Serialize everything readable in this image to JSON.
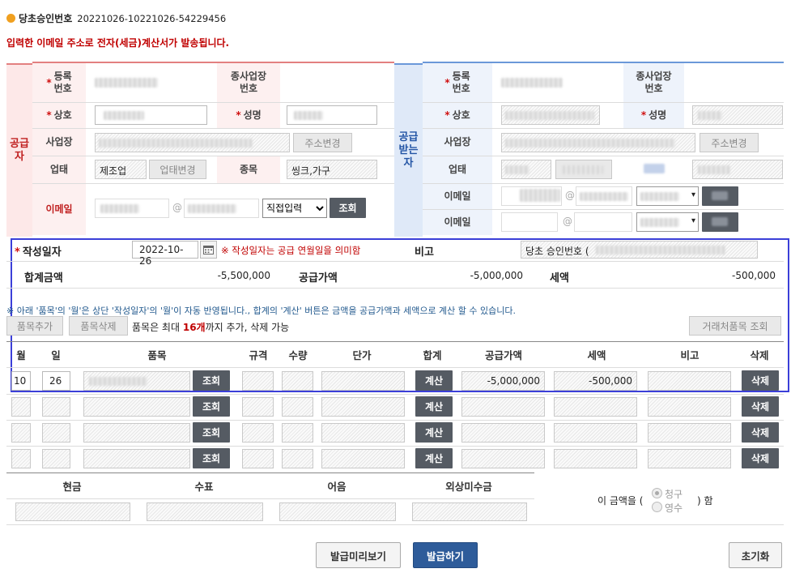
{
  "header": {
    "title": "당초승인번호",
    "approval_number": "20221026-10221026-54229456"
  },
  "notice": "입력한 이메일 주소로 전자(세금)계산서가 발송됩니다.",
  "supplier": {
    "side_label": "공급\n자",
    "reg_label": "등록\n번호",
    "sub_label": "종사업장\n번호",
    "name_label": "상호",
    "ceo_label": "성명",
    "address_label": "사업장",
    "address_btn": "주소변경",
    "biz_type_label": "업태",
    "biz_type_value": "제조업",
    "biz_type_btn": "업태변경",
    "item_label": "종목",
    "item_value": "씽크,가구",
    "email_label": "이메일",
    "email_at": "@",
    "email_domain_select": "직접입력",
    "lookup_btn": "조회"
  },
  "receiver": {
    "side_label": "공급\n받는\n자",
    "reg_label": "등록\n번호",
    "sub_label": "종사업장\n번호",
    "name_label": "상호",
    "ceo_label": "성명",
    "address_label": "사업장",
    "address_btn": "주소변경",
    "biz_type_label": "업태",
    "email_label1": "이메일",
    "email_label2": "이메일",
    "email_at": "@"
  },
  "summary": {
    "date_label": "작성일자",
    "date_value": "2022-10-26",
    "date_note": "※ 작성일자는 공급 연월일을 의미함",
    "remark_label": "비고",
    "remark_value": "당초 승인번호 (",
    "total_label": "합계금액",
    "total_value": "-5,500,000",
    "supply_label": "공급가액",
    "supply_value": "-5,000,000",
    "tax_label": "세액",
    "tax_value": "-500,000"
  },
  "info_note": "※ 아래 '품목'의 '월'은 상단 '작성일자'의 '월'이 자동 반영됩니다., 합계의 '계산' 버튼은 금액을 공급가액과 세액으로 계산 할 수 있습니다.",
  "toolbar": {
    "add_btn": "품목추가",
    "delete_btn": "품목삭제",
    "limit_pre": "품목은 최대 ",
    "limit_num": "16개",
    "limit_post": "까지 추가, 삭제 가능",
    "partner_btn": "거래처품목 조회"
  },
  "items_table": {
    "headers": [
      "월",
      "일",
      "품목",
      "규격",
      "수량",
      "단가",
      "합계",
      "공급가액",
      "세액",
      "비고",
      "삭제"
    ],
    "lookup_label": "조회",
    "calc_label": "계산",
    "delete_label": "삭제",
    "first_row": {
      "month": "10",
      "day": "26",
      "supply": "-5,000,000",
      "tax": "-500,000"
    }
  },
  "payment": {
    "headers": [
      "현금",
      "수표",
      "어음",
      "외상미수금"
    ],
    "text_pre": "이 금액을 (",
    "text_post": ") 함",
    "opt_bill": "청구",
    "opt_receipt": "영수"
  },
  "footer": {
    "preview_btn": "발급미리보기",
    "issue_btn": "발급하기",
    "reset_btn": "초기화"
  },
  "colors": {
    "notice": "#c00000",
    "highlight": "#3b3fd8",
    "primary": "#2e5c9a"
  }
}
